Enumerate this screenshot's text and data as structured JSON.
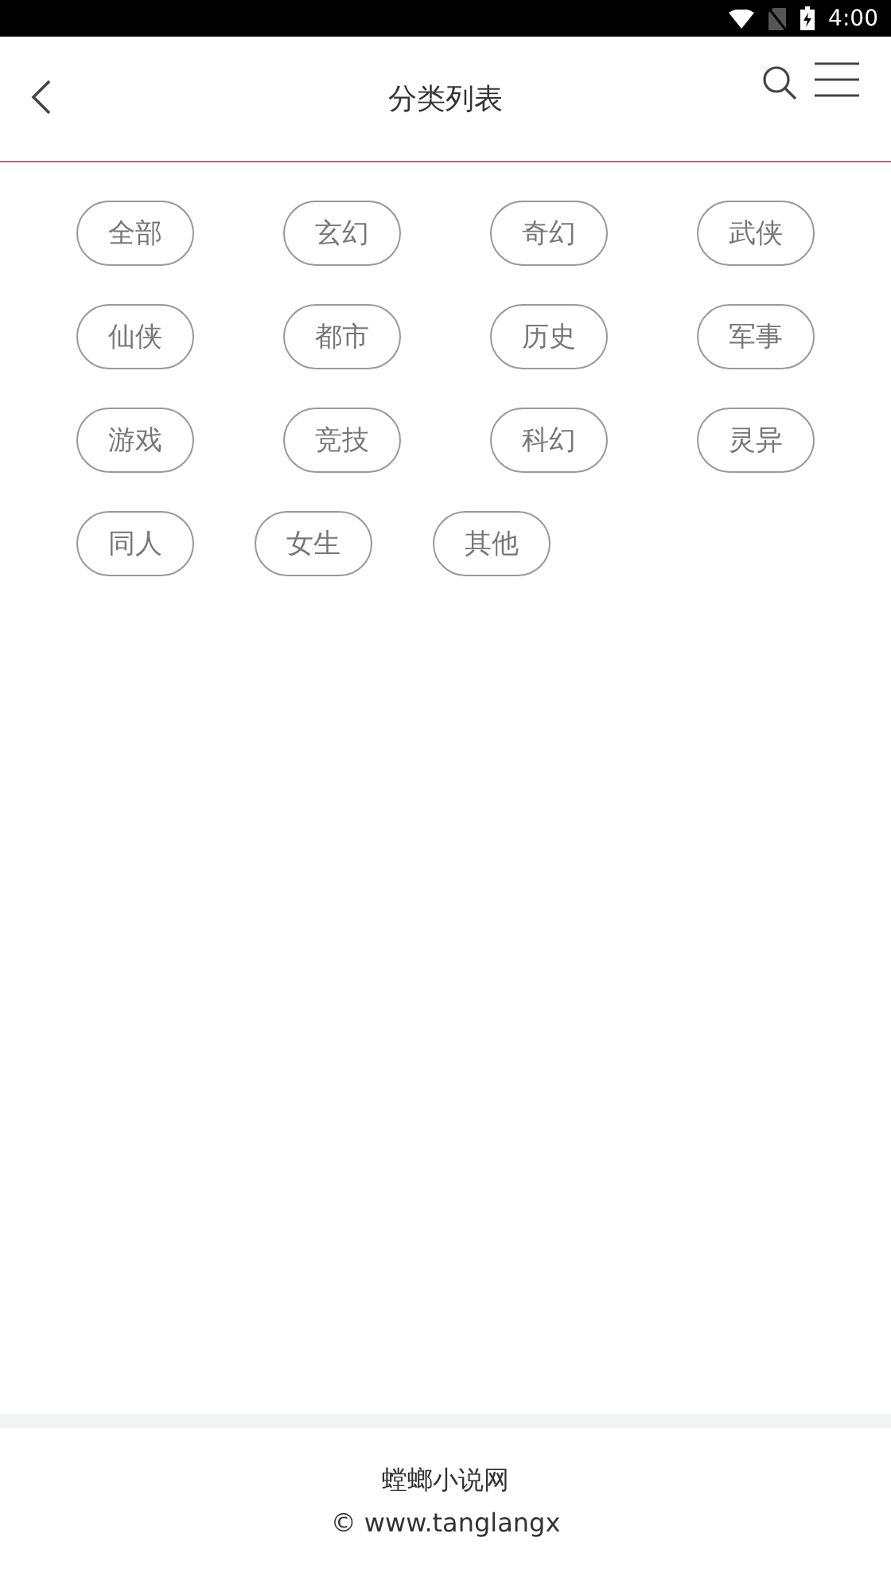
{
  "status_bar": {
    "time": "4:00"
  },
  "header": {
    "title": "分类列表"
  },
  "categories": [
    {
      "label": "全部"
    },
    {
      "label": "玄幻"
    },
    {
      "label": "奇幻"
    },
    {
      "label": "武侠"
    },
    {
      "label": "仙侠"
    },
    {
      "label": "都市"
    },
    {
      "label": "历史"
    },
    {
      "label": "军事"
    },
    {
      "label": "游戏"
    },
    {
      "label": "竞技"
    },
    {
      "label": "科幻"
    },
    {
      "label": "灵异"
    },
    {
      "label": "同人"
    },
    {
      "label": "女生"
    },
    {
      "label": "其他"
    }
  ],
  "footer": {
    "site_name": "螳螂小说网",
    "copyright": "© www.tanglangx"
  }
}
